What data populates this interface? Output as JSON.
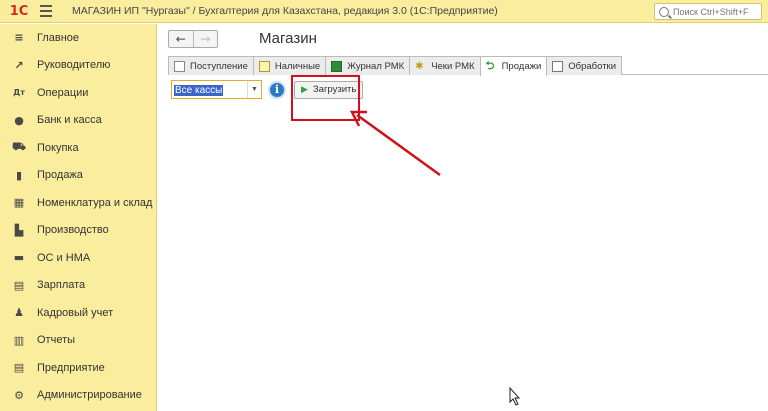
{
  "titlebar": {
    "logo": "1С",
    "title": "МАГАЗИН ИП \"Нургазы\" / Бухгалтерия для Казахстана, редакция 3.0  (1С:Предприятие)",
    "search_placeholder": "Поиск Ctrl+Shift+F"
  },
  "sidebar": {
    "items": [
      {
        "label": "Главное",
        "icon": "≡"
      },
      {
        "label": "Руководителю",
        "icon": "↗"
      },
      {
        "label": "Операции",
        "icon": "Дт"
      },
      {
        "label": "Банк и касса",
        "icon": "●"
      },
      {
        "label": "Покупка",
        "icon": "⛟"
      },
      {
        "label": "Продажа",
        "icon": "▮"
      },
      {
        "label": "Номенклатура и склад",
        "icon": "▦"
      },
      {
        "label": "Производство",
        "icon": "▙"
      },
      {
        "label": "ОС и НМА",
        "icon": "▬"
      },
      {
        "label": "Зарплата",
        "icon": "▤"
      },
      {
        "label": "Кадровый учет",
        "icon": "♟"
      },
      {
        "label": "Отчеты",
        "icon": "▥"
      },
      {
        "label": "Предприятие",
        "icon": "▤"
      },
      {
        "label": "Администрирование",
        "icon": "⚙"
      }
    ]
  },
  "main": {
    "title": "Магазин",
    "back": "←",
    "forward": "→",
    "tabs": [
      {
        "label": "Поступление"
      },
      {
        "label": "Наличные"
      },
      {
        "label": "Журнал РМК"
      },
      {
        "label": "Чеки РМК"
      },
      {
        "label": "Продажи"
      },
      {
        "label": "Обработки"
      }
    ],
    "cash_select": "Все кассы",
    "info": "i",
    "load_button": "Загрузить"
  },
  "colors": {
    "sidebar_bg": "#fbed9e",
    "annotation": "#d0111b",
    "select_border": "#e6a92a"
  }
}
